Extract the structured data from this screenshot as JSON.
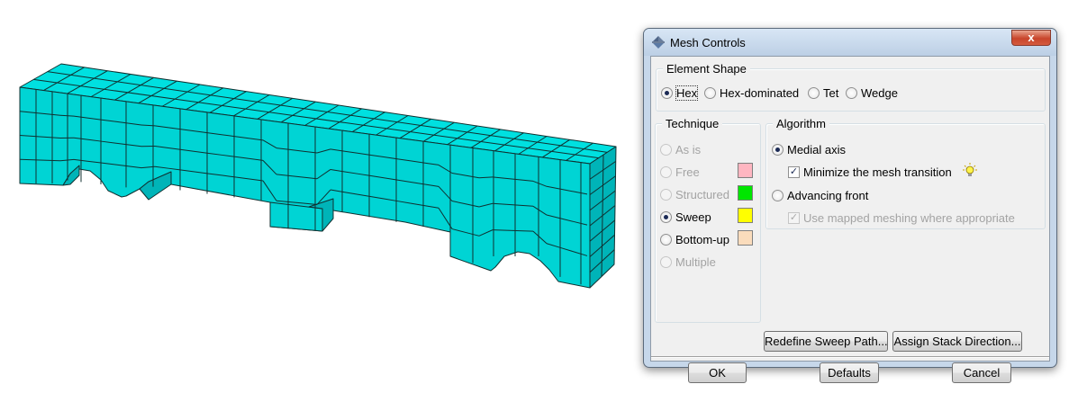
{
  "dialog": {
    "title": "Mesh Controls",
    "close_symbol": "x"
  },
  "element_shape": {
    "title": "Element Shape",
    "options": [
      {
        "label": "Hex",
        "checked": true
      },
      {
        "label": "Hex-dominated",
        "checked": false
      },
      {
        "label": "Tet",
        "checked": false
      },
      {
        "label": "Wedge",
        "checked": false
      }
    ]
  },
  "technique": {
    "title": "Technique",
    "options": [
      {
        "label": "As is",
        "checked": false,
        "enabled": false,
        "color": null
      },
      {
        "label": "Free",
        "checked": false,
        "enabled": false,
        "color": "#ffb6c1"
      },
      {
        "label": "Structured",
        "checked": false,
        "enabled": false,
        "color": "#00e600"
      },
      {
        "label": "Sweep",
        "checked": true,
        "enabled": true,
        "color": "#ffff00"
      },
      {
        "label": "Bottom-up",
        "checked": false,
        "enabled": true,
        "color": "#fadcbc"
      },
      {
        "label": "Multiple",
        "checked": false,
        "enabled": false,
        "color": null
      }
    ]
  },
  "algorithm": {
    "title": "Algorithm",
    "medial_axis": {
      "label": "Medial axis",
      "checked": true
    },
    "minimize_transition": {
      "label": "Minimize the mesh transition",
      "checked": true
    },
    "advancing_front": {
      "label": "Advancing front",
      "checked": false
    },
    "use_mapped": {
      "label": "Use mapped meshing where appropriate",
      "checked": true,
      "enabled": false
    }
  },
  "actions": {
    "redefine_sweep": "Redefine Sweep Path...",
    "assign_stack": "Assign Stack Direction..."
  },
  "footer": {
    "ok": "OK",
    "defaults": "Defaults",
    "cancel": "Cancel"
  },
  "colors": {
    "mesh_fill": "#00d4d4",
    "mesh_side": "#00b4b8",
    "mesh_top": "#00e0e0",
    "mesh_line": "#103030",
    "dialog_frame": "#c6d7ea",
    "close_button": "#c8452b"
  },
  "icons": {
    "title": "mesh-controls-icon",
    "hint": "lightbulb-icon",
    "close": "close-icon"
  }
}
